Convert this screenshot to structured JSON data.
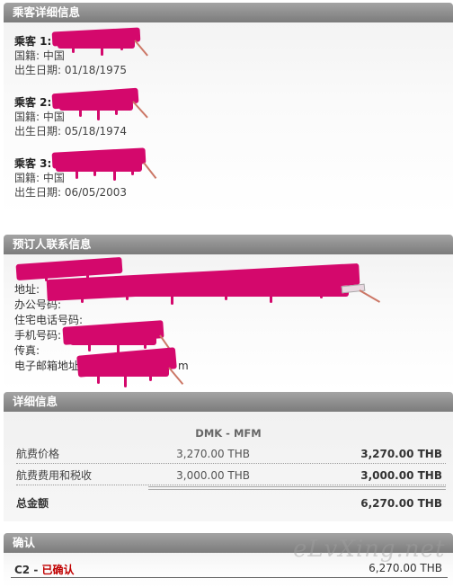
{
  "passenger_section": {
    "title": "乘客详细信息",
    "passengers": [
      {
        "label": "乘客 1:",
        "nationality": "国籍: 中国",
        "dob": "出生日期: 01/18/1975"
      },
      {
        "label": "乘客 2:",
        "nationality": "国籍: 中国",
        "dob": "出生日期: 05/18/1974"
      },
      {
        "label": "乘客 3:",
        "nationality": "国籍: 中国",
        "dob": "出生日期: 06/05/2003"
      }
    ]
  },
  "contact_section": {
    "title": "预订人联系信息",
    "address_label": "地址:",
    "office_phone_label": "办公号码:",
    "home_phone_label": "住宅电话号码:",
    "mobile_label": "手机号码:",
    "fax_label": "传真:",
    "email_label": "电子邮箱地址",
    "email_suffix": "m"
  },
  "detail_section": {
    "title": "详细信息",
    "route": "DMK - MFM",
    "rows": [
      {
        "label": "航费价格",
        "unit_price": "3,270.00 THB",
        "amount": "3,270.00 THB"
      },
      {
        "label": "航费费用和税收",
        "unit_price": "3,000.00 THB",
        "amount": "3,000.00 THB"
      }
    ],
    "total_label": "总金额",
    "total_amount": "6,270.00 THB"
  },
  "confirm_section": {
    "title": "确认",
    "code": "C2",
    "separator": " - ",
    "status": "已确认",
    "amount": "6,270.00 THB"
  },
  "watermark": "eLvXing.net",
  "colors": {
    "header_gray": "#8e8e8e",
    "redaction": "#d4086c",
    "status_red": "#c00000"
  }
}
